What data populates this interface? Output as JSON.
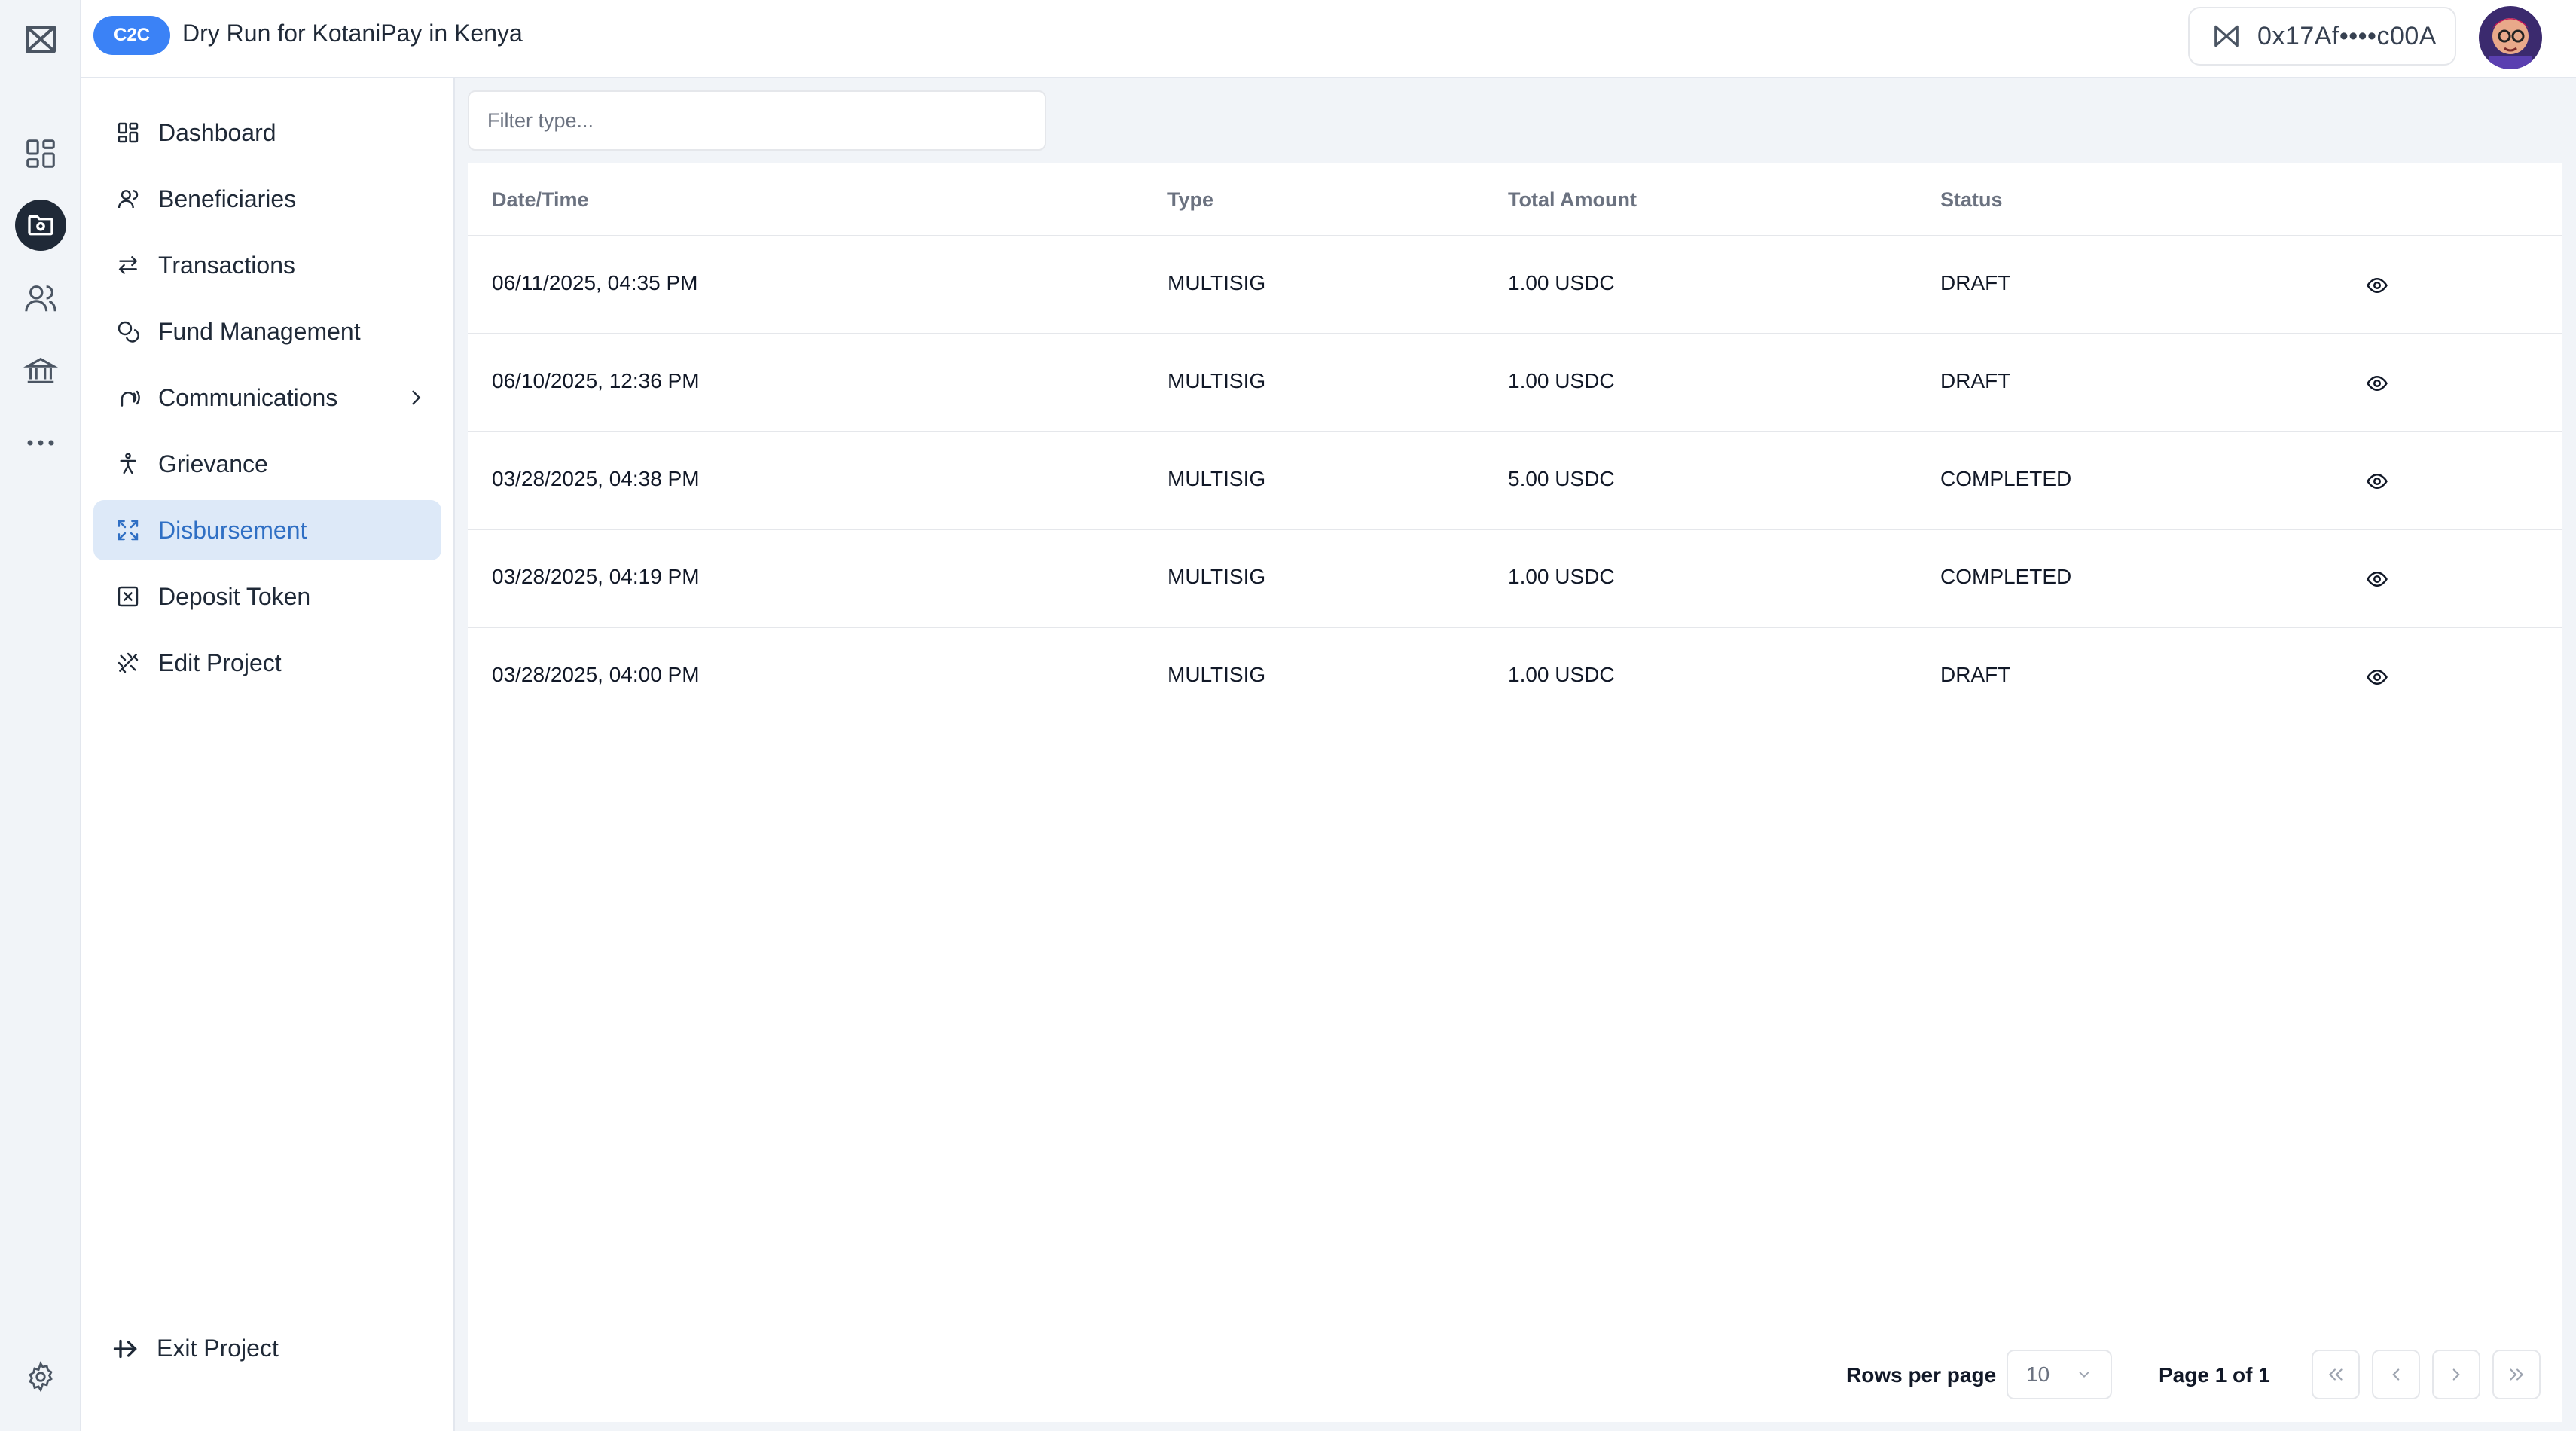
{
  "topbar": {
    "badge": "C2C",
    "project_title": "Dry Run for KotaniPay in Kenya",
    "wallet_address": "0x17Af••••c00A"
  },
  "rail": {
    "icons": [
      "logo-icon",
      "grid-icon",
      "folder-icon",
      "users-icon",
      "bank-icon",
      "more-icon",
      "settings-icon"
    ],
    "active": "folder-icon"
  },
  "sidebar": {
    "items": [
      {
        "label": "Dashboard",
        "icon": "dashboard-icon"
      },
      {
        "label": "Beneficiaries",
        "icon": "user-icon"
      },
      {
        "label": "Transactions",
        "icon": "transfer-icon"
      },
      {
        "label": "Fund Management",
        "icon": "coins-icon"
      },
      {
        "label": "Communications",
        "icon": "broadcast-icon"
      },
      {
        "label": "Grievance",
        "icon": "person-icon"
      },
      {
        "label": "Disbursement",
        "icon": "expand-icon"
      },
      {
        "label": "Deposit Token",
        "icon": "token-icon"
      },
      {
        "label": "Edit Project",
        "icon": "edit-project-icon"
      }
    ],
    "active": "Disbursement",
    "exit_label": "Exit Project"
  },
  "filter": {
    "placeholder": "Filter type..."
  },
  "table": {
    "headers": [
      "Date/Time",
      "Type",
      "Total Amount",
      "Status"
    ],
    "rows": [
      {
        "date": "06/11/2025, 04:35 PM",
        "type": "MULTISIG",
        "amount": "1.00 USDC",
        "status": "DRAFT"
      },
      {
        "date": "06/10/2025, 12:36 PM",
        "type": "MULTISIG",
        "amount": "1.00 USDC",
        "status": "DRAFT"
      },
      {
        "date": "03/28/2025, 04:38 PM",
        "type": "MULTISIG",
        "amount": "5.00 USDC",
        "status": "COMPLETED"
      },
      {
        "date": "03/28/2025, 04:19 PM",
        "type": "MULTISIG",
        "amount": "1.00 USDC",
        "status": "COMPLETED"
      },
      {
        "date": "03/28/2025, 04:00 PM",
        "type": "MULTISIG",
        "amount": "1.00 USDC",
        "status": "DRAFT"
      }
    ]
  },
  "pagination": {
    "rows_label": "Rows per page",
    "rows_value": "10",
    "page_info": "Page 1 of 1"
  },
  "colors": {
    "accent": "#3b82f6",
    "active_bg": "#dde9f8",
    "active_text": "#2f6fc4",
    "rail_active": "#1f2937"
  }
}
